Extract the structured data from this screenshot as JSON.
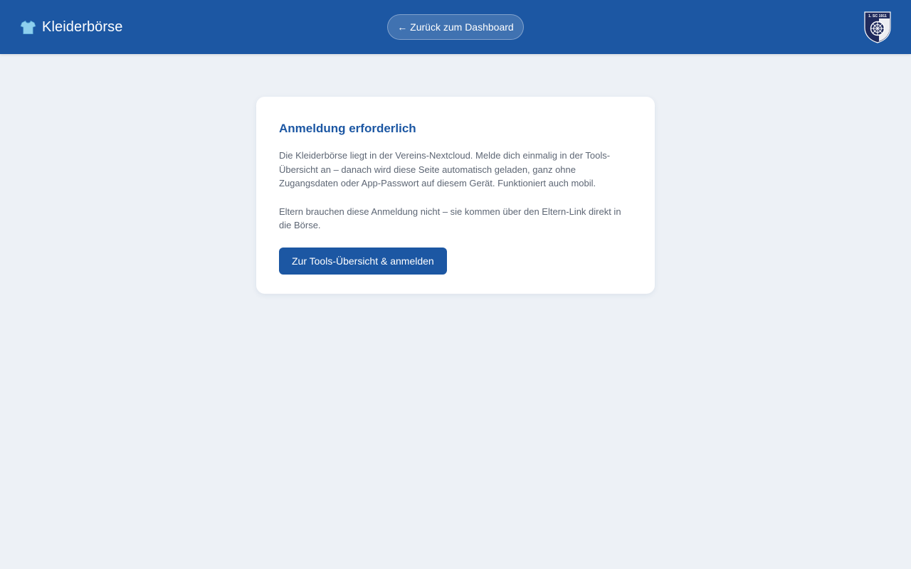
{
  "header": {
    "title": "Kleiderbörse",
    "brand_icon": "tshirt-icon",
    "back_button_label": "← Zurück zum Dashboard",
    "club_logo": {
      "icon": "club-crest-icon",
      "text": "1. SC 1911"
    },
    "colors": {
      "background": "#1c57a3",
      "crest_navy": "#1f2a5c"
    }
  },
  "card": {
    "title": "Anmeldung erforderlich",
    "paragraph_1": "Die Kleiderbörse liegt in der Vereins-Nextcloud. Melde dich einmalig in der Tools-Übersicht an – danach wird diese Seite automatisch geladen, ganz ohne Zugangsdaten oder App-Passwort auf diesem Gerät. Funktioniert auch mobil.",
    "paragraph_2": "Eltern brauchen diese Anmeldung nicht – sie kommen über den Eltern-Link direkt in die Börse.",
    "button_label": "Zur Tools-Übersicht & anmelden"
  },
  "colors": {
    "page_background": "#edf1f6",
    "accent": "#1c57a3",
    "text_muted": "#5d6674"
  }
}
